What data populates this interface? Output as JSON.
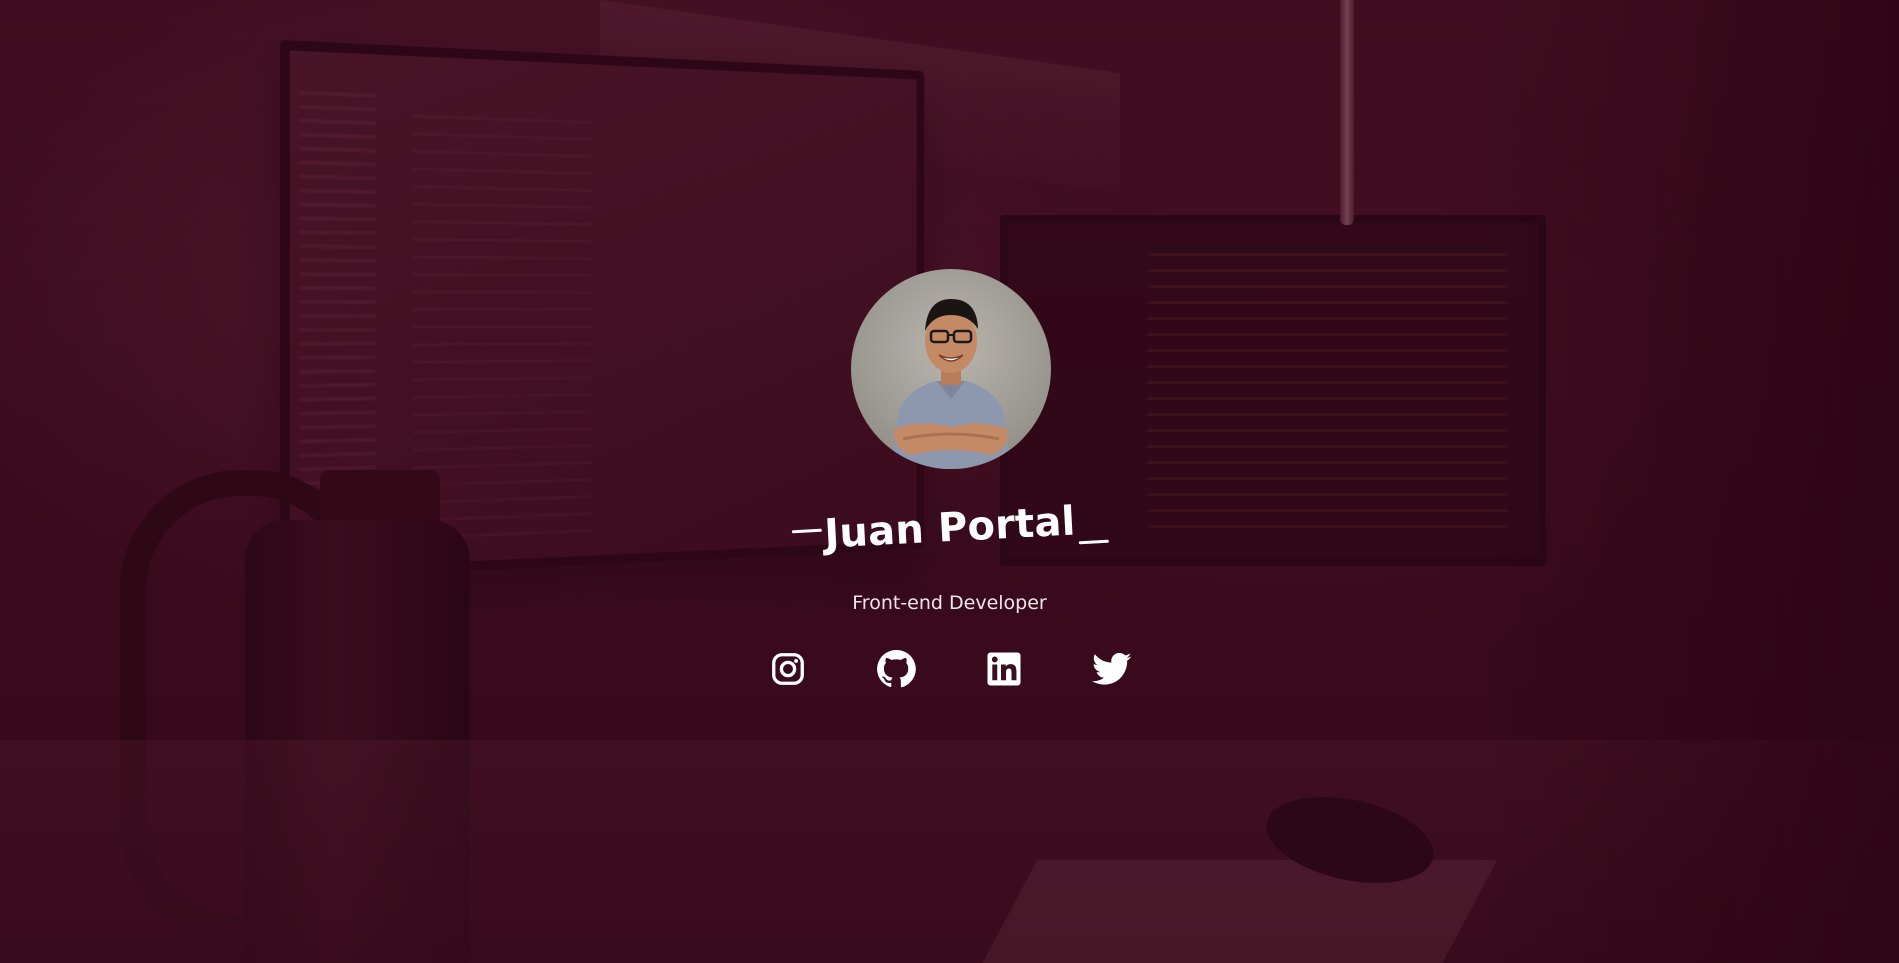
{
  "profile": {
    "name": "Juan Portal",
    "role": "Front-end Developer",
    "avatar_alt": "Juan Portal"
  },
  "social_links": [
    {
      "icon": "instagram-icon",
      "label": "Instagram"
    },
    {
      "icon": "github-icon",
      "label": "GitHub"
    },
    {
      "icon": "linkedin-icon",
      "label": "LinkedIn"
    },
    {
      "icon": "twitter-icon",
      "label": "Twitter"
    }
  ],
  "colors": {
    "overlay": "#3a081c",
    "text": "#ffffff",
    "subtitle": "#f1e6ea"
  }
}
